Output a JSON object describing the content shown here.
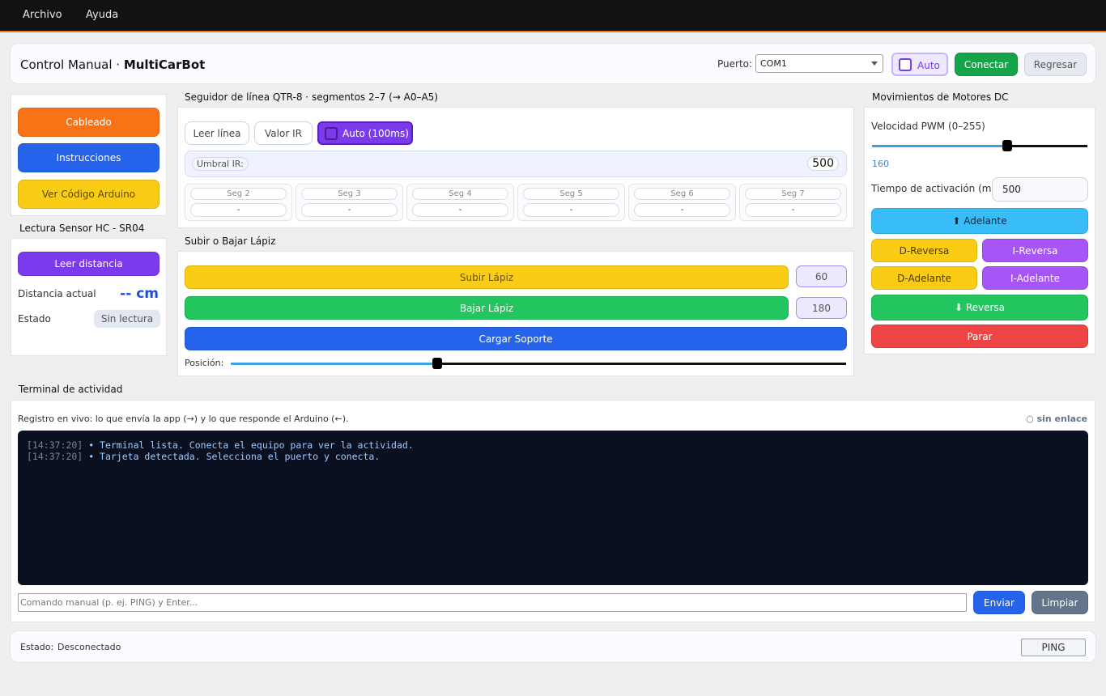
{
  "menubar": {
    "items": [
      "Archivo",
      "Ayuda"
    ]
  },
  "header": {
    "title_prefix": "Control Manual ·",
    "title_bold": "MultiCarBot",
    "port_label": "Puerto:",
    "port_value": "COM1",
    "auto_label": "Auto",
    "connect_label": "Conectar",
    "back_label": "Regresar"
  },
  "left": {
    "buttons": [
      "Cableado",
      "Instrucciones",
      "Ver Código Arduino"
    ],
    "sensor_title": "Lectura Sensor HC - SR04",
    "read_distance": "Leer distancia",
    "distance_label": "Distancia actual",
    "distance_value": "-- cm",
    "status_label": "Estado",
    "status_value": "Sin lectura"
  },
  "line_follower": {
    "title": "Seguidor de línea QTR-8 · segmentos 2–7 (→ A0–A5)",
    "read_line": "Leer línea",
    "ir_value": "Valor IR",
    "auto": "Auto (100ms)",
    "threshold_label": "Umbral IR:",
    "threshold_value": "500",
    "segments": [
      {
        "name": "Seg 2",
        "value": "-"
      },
      {
        "name": "Seg 3",
        "value": "-"
      },
      {
        "name": "Seg 4",
        "value": "-"
      },
      {
        "name": "Seg 5",
        "value": "-"
      },
      {
        "name": "Seg 6",
        "value": "-"
      },
      {
        "name": "Seg 7",
        "value": "-"
      }
    ]
  },
  "pen": {
    "title": "Subir o Bajar Lápiz",
    "up_label": "Subir Lápiz",
    "up_value": "60",
    "down_label": "Bajar Lápiz",
    "down_value": "180",
    "load_label": "Cargar Soporte",
    "position_label": "Posición:",
    "position_fraction": 0.335
  },
  "motors": {
    "title": "Movimientos de Motores DC",
    "pwm_label": "Velocidad PWM (0–255)",
    "pwm_value": "160",
    "pwm_fraction": 0.627,
    "time_label": "Tiempo de activación (ms)",
    "time_value": "500",
    "forward": "⬆ Adelante",
    "d_reverse": "D-Reversa",
    "i_reverse": "I-Reversa",
    "d_forward": "D-Adelante",
    "i_forward": "I-Adelante",
    "reverse": "⬇ Reversa",
    "stop": "Parar"
  },
  "terminal": {
    "title": "Terminal de actividad",
    "description": "Registro en vivo: lo que envía la app (→) y lo que responde el Arduino (←).",
    "link_status": "○ sin enlace",
    "lines": [
      {
        "time": "[14:37:20]",
        "msg": "• Terminal lista. Conecta el equipo para ver la actividad."
      },
      {
        "time": "[14:37:20]",
        "msg": "• Tarjeta detectada. Selecciona el puerto y conecta."
      }
    ],
    "input_placeholder": "Comando manual (p. ej. PING) y Enter...",
    "send": "Enviar",
    "clear": "Limpiar"
  },
  "statusbar": {
    "label": "Estado:",
    "value": "Desconectado",
    "ping": "PING"
  },
  "colors": {
    "orange": "#f97316",
    "blue": "#2563eb",
    "yellow": "#facc15",
    "purple": "#7c3aed",
    "green": "#16a34a",
    "sky": "#38bdf8",
    "red": "#ef4444"
  }
}
